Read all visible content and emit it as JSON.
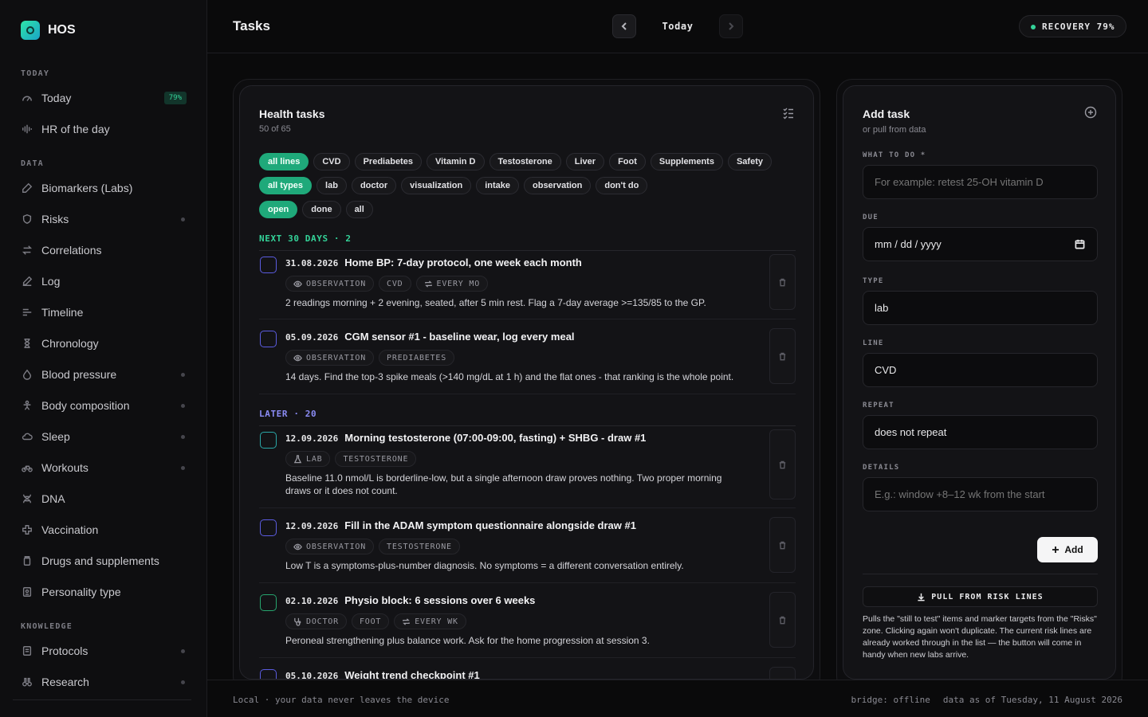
{
  "app": {
    "name": "HOS"
  },
  "sidebar": {
    "sections": [
      {
        "label": "TODAY"
      },
      {
        "label": "DATA"
      },
      {
        "label": "KNOWLEDGE"
      }
    ],
    "items": [
      {
        "label": "Today",
        "badge": "79%"
      },
      {
        "label": "HR of the day"
      },
      {
        "label": "Biomarkers (Labs)"
      },
      {
        "label": "Risks"
      },
      {
        "label": "Correlations"
      },
      {
        "label": "Log"
      },
      {
        "label": "Timeline"
      },
      {
        "label": "Chronology"
      },
      {
        "label": "Blood pressure"
      },
      {
        "label": "Body composition"
      },
      {
        "label": "Sleep"
      },
      {
        "label": "Workouts"
      },
      {
        "label": "DNA"
      },
      {
        "label": "Vaccination"
      },
      {
        "label": "Drugs and supplements"
      },
      {
        "label": "Personality type"
      },
      {
        "label": "Protocols"
      },
      {
        "label": "Research"
      }
    ]
  },
  "header": {
    "title": "Tasks",
    "date_label": "Today",
    "recovery": "RECOVERY 79%"
  },
  "tasks_panel": {
    "title": "Health tasks",
    "count": "50 of 65",
    "line_filters": [
      "all lines",
      "CVD",
      "Prediabetes",
      "Vitamin D",
      "Testosterone",
      "Liver",
      "Foot",
      "Supplements",
      "Safety"
    ],
    "type_filters": [
      "all types",
      "lab",
      "doctor",
      "visualization",
      "intake",
      "observation",
      "don't do"
    ],
    "status_filters": [
      "open",
      "done",
      "all"
    ],
    "groups": [
      {
        "label": "NEXT 30 DAYS · 2"
      },
      {
        "label": "LATER · 20"
      }
    ],
    "tasks": [
      {
        "date": "31.08.2026",
        "title": "Home BP: 7-day protocol, one week each month",
        "tags": [
          "OBSERVATION",
          "CVD",
          "EVERY MO"
        ],
        "desc": "2 readings morning + 2 evening, seated, after 5 min rest. Flag a 7-day average >=135/85 to the GP."
      },
      {
        "date": "05.09.2026",
        "title": "CGM sensor #1 - baseline wear, log every meal",
        "tags": [
          "OBSERVATION",
          "PREDIABETES"
        ],
        "desc": "14 days. Find the top-3 spike meals (>140 mg/dL at 1 h) and the flat ones - that ranking is the whole point."
      },
      {
        "date": "12.09.2026",
        "title": "Morning testosterone (07:00-09:00, fasting) + SHBG - draw #1",
        "tags": [
          "LAB",
          "TESTOSTERONE"
        ],
        "desc": "Baseline 11.0 nmol/L is borderline-low, but a single afternoon draw proves nothing. Two proper morning draws or it does not count."
      },
      {
        "date": "12.09.2026",
        "title": "Fill in the ADAM symptom questionnaire alongside draw #1",
        "tags": [
          "OBSERVATION",
          "TESTOSTERONE"
        ],
        "desc": "Low T is a symptoms-plus-number diagnosis. No symptoms = a different conversation entirely."
      },
      {
        "date": "02.10.2026",
        "title": "Physio block: 6 sessions over 6 weeks",
        "tags": [
          "DOCTOR",
          "FOOT",
          "EVERY WK"
        ],
        "desc": "Peroneal strengthening plus balance work. Ask for the home progression at session 3."
      },
      {
        "date": "05.10.2026",
        "title": "Weight trend checkpoint #1",
        "tags": [],
        "desc": ""
      }
    ]
  },
  "add_panel": {
    "title": "Add task",
    "sub": "or pull from data",
    "what_label": "WHAT TO DO *",
    "what_placeholder": "For example: retest 25-OH vitamin D",
    "due_label": "DUE",
    "due_value": "mm / dd / yyyy",
    "type_label": "TYPE",
    "type_value": "lab",
    "line_label": "LINE",
    "line_value": "CVD",
    "repeat_label": "REPEAT",
    "repeat_value": "does not repeat",
    "details_label": "DETAILS",
    "details_placeholder": "E.g.: window +8–12 wk from the start",
    "add_label": "Add",
    "pull_label": "PULL FROM RISK LINES",
    "pull_desc": "Pulls the \"still to test\" items and marker targets from the \"Risks\" zone. Clicking again won't duplicate. The current risk lines are already worked through in the list — the button will come in handy when new labs arrive."
  },
  "footer": {
    "left": "Local · your data never leaves the device",
    "bridge": "bridge: offline",
    "asof": "data as of Tuesday, 11 August 2026"
  },
  "colors": {
    "accent": "#34d399",
    "later": "#8b8cf5"
  }
}
